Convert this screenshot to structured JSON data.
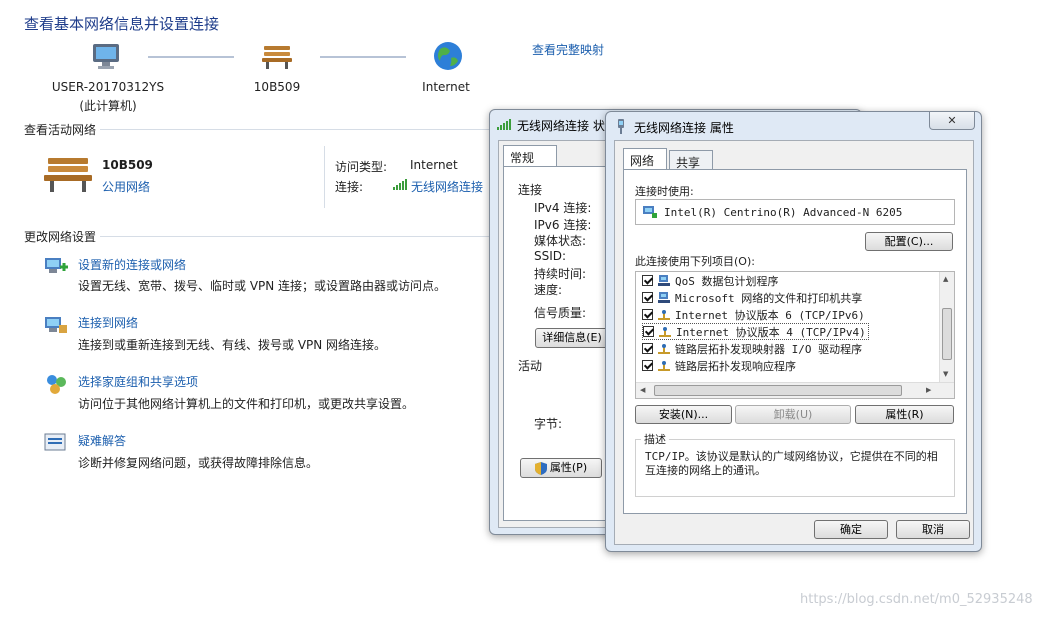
{
  "network_center": {
    "title": "查看基本网络信息并设置连接",
    "view_full_map": "查看完整映射",
    "map": {
      "computer_name": "USER-20170312YS",
      "computer_sub": "(此计算机)",
      "network_name": "10B509",
      "internet": "Internet"
    },
    "active_heading": "查看活动网络",
    "active": {
      "name": "10B509",
      "type_link": "公用网络",
      "access_type_label": "访问类型:",
      "access_type_value": "Internet",
      "connection_label": "连接:",
      "connection_value": "无线网络连接"
    },
    "change_heading": "更改网络设置",
    "tasks": [
      {
        "link": "设置新的连接或网络",
        "desc": "设置无线、宽带、拨号、临时或 VPN 连接；或设置路由器或访问点。",
        "icon": "new-connection-icon"
      },
      {
        "link": "连接到网络",
        "desc": "连接到或重新连接到无线、有线、拨号或 VPN 网络连接。",
        "icon": "connect-network-icon"
      },
      {
        "link": "选择家庭组和共享选项",
        "desc": "访问位于其他网络计算机上的文件和打印机，或更改共享设置。",
        "icon": "homegroup-icon"
      },
      {
        "link": "疑难解答",
        "desc": "诊断并修复网络问题，或获得故障排除信息。",
        "icon": "troubleshoot-icon"
      }
    ]
  },
  "status_dialog": {
    "title": "无线网络连接 状",
    "tab_general": "常规",
    "group_connection": "连接",
    "rows": [
      "IPv4 连接:",
      "IPv6 连接:",
      "媒体状态:",
      "SSID:",
      "持续时间:",
      "速度:"
    ],
    "signal_quality": "信号质量:",
    "details_button": "详细信息(E)",
    "group_activity": "活动",
    "bytes_label": "字节:",
    "properties_button": "属性(P)"
  },
  "props_dialog": {
    "title": "无线网络连接 属性",
    "close_glyph": "✕",
    "tab_network": "网络",
    "tab_sharing": "共享",
    "connect_using_label": "连接时使用:",
    "adapter": "Intel(R) Centrino(R) Advanced-N 6205",
    "configure_button": "配置(C)...",
    "items_label": "此连接使用下列项目(O):",
    "items": [
      "QoS 数据包计划程序",
      "Microsoft 网络的文件和打印机共享",
      "Internet 协议版本 6 (TCP/IPv6)",
      "Internet 协议版本 4 (TCP/IPv4)",
      "链路层拓扑发现映射器 I/O 驱动程序",
      "链路层拓扑发现响应程序"
    ],
    "install_button": "安装(N)...",
    "uninstall_button": "卸载(U)",
    "properties_button": "属性(R)",
    "description_label": "描述",
    "description_text": "TCP/IP。该协议是默认的广域网络协议，它提供在不同的相互连接的网络上的通讯。",
    "ok_button": "确定",
    "cancel_button": "取消"
  },
  "watermark": "https://blog.csdn.net/m0_52935248",
  "colors": {
    "link": "#1c5fae",
    "title": "#1e3c8a",
    "dialog_frame": "#dfe9f5"
  }
}
